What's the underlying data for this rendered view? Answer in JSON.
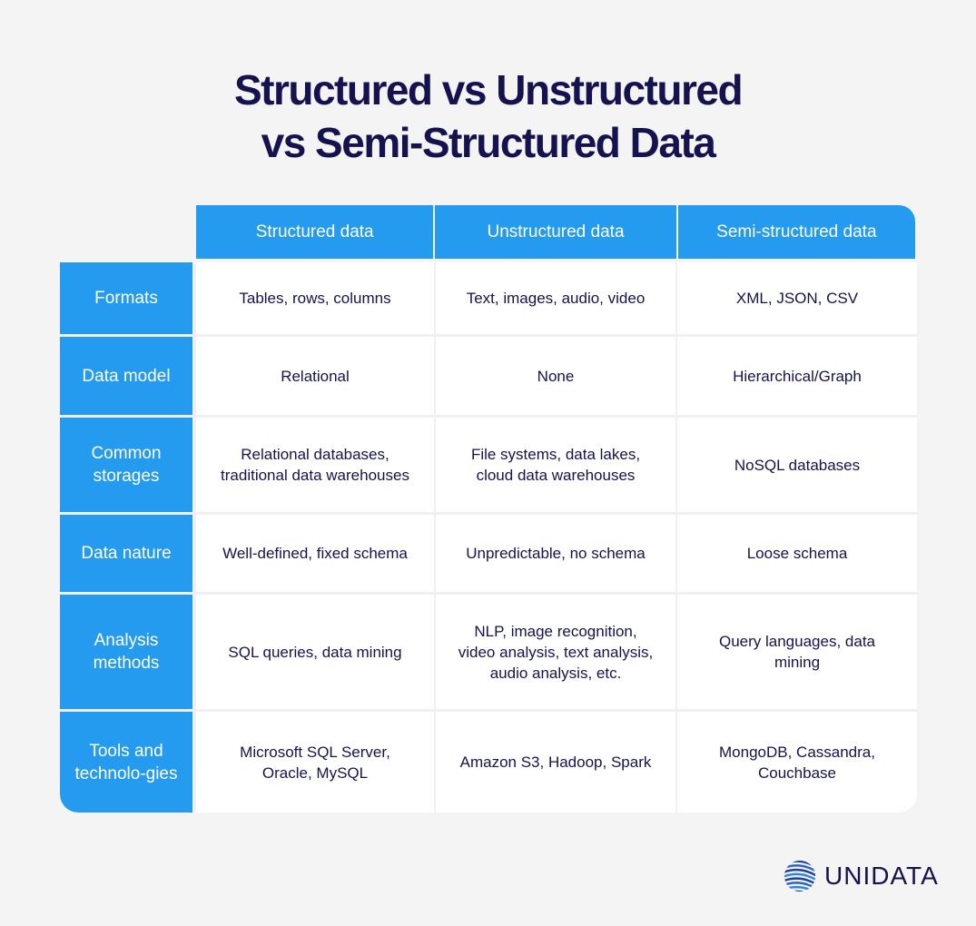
{
  "title": {
    "line1": "Structured vs Unstructured",
    "line2": "vs Semi-Structured Data"
  },
  "columns": [
    "Structured data",
    "Unstructured data",
    "Semi-structured data"
  ],
  "rows": [
    {
      "label": "Formats",
      "cells": [
        "Tables, rows, columns",
        "Text, images, audio, video",
        "XML, JSON, CSV"
      ]
    },
    {
      "label": "Data model",
      "cells": [
        "Relational",
        "None",
        "Hierarchical/Graph"
      ]
    },
    {
      "label": "Common storages",
      "cells": [
        "Relational databases, traditional data warehouses",
        "File systems, data lakes, cloud data warehouses",
        "NoSQL databases"
      ]
    },
    {
      "label": "Data nature",
      "cells": [
        "Well-defined, fixed schema",
        "Unpredictable, no schema",
        "Loose schema"
      ]
    },
    {
      "label": "Analysis methods",
      "cells": [
        "SQL queries, data mining",
        "NLP, image recognition, video analysis, text analysis, audio analysis, etc.",
        "Query languages, data mining"
      ]
    },
    {
      "label": "Tools and technolo-gies",
      "cells": [
        "Microsoft SQL Server, Oracle, MySQL",
        "Amazon S3, Hadoop, Spark",
        "MongoDB, Cassandra, Couchbase"
      ]
    }
  ],
  "logo": {
    "text": "UNIDATA",
    "icon": "striped-globe-icon"
  },
  "colors": {
    "accent": "#259bf0",
    "text_dark": "#15134f",
    "background": "#f4f4f5"
  }
}
